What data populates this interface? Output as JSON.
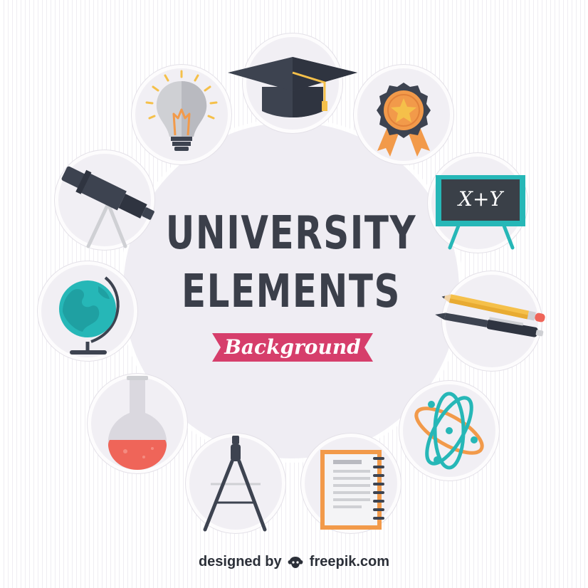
{
  "colors": {
    "background": "#ffffff",
    "stripe": "#efedf2",
    "disc": "#efedf3",
    "title_text": "#3b3f4a",
    "ribbon": "#d63e6b",
    "accent_teal": "#26b7b7",
    "accent_orange": "#f29a4a",
    "accent_red": "#ef6559",
    "accent_yellow": "#f5c04a",
    "dark_gray": "#3d4350"
  },
  "title": {
    "line1": "UNIVERSITY",
    "line2": "ELEMENTS"
  },
  "ribbon": {
    "label": "Background"
  },
  "chalkboard": {
    "text": "X+Y"
  },
  "credit": {
    "prefix": "designed by",
    "brand": "freepik.com"
  },
  "icons": [
    "graduation-cap-icon",
    "award-badge-icon",
    "chalkboard-icon",
    "pencil-pen-icon",
    "atom-icon",
    "notebook-icon",
    "compass-icon",
    "flask-icon",
    "globe-icon",
    "telescope-icon",
    "light-bulb-icon"
  ]
}
